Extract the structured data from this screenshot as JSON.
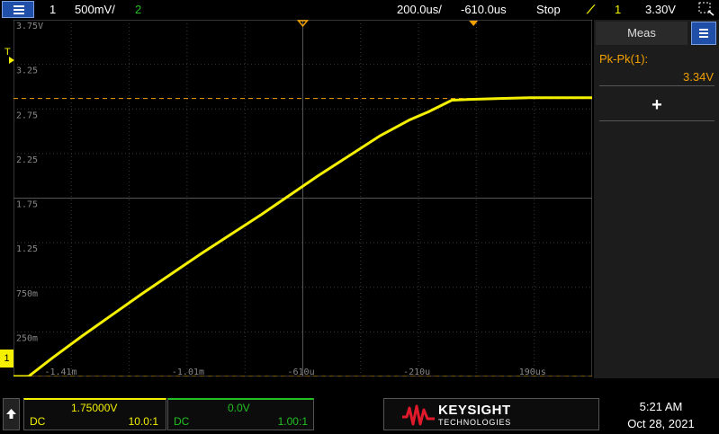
{
  "topbar": {
    "channel1_num": "1",
    "channel1_scale": "500mV/",
    "channel2_num": "2",
    "time_scale": "200.0us/",
    "time_offset": "-610.0us",
    "run_state": "Stop",
    "trigger_channel": "1",
    "trigger_level": "3.30V",
    "trigger_icon": "trigger-rising-edge-icon",
    "zoom_icon": "zoom-box-icon"
  },
  "graticule": {
    "y_tick_labels": [
      "3.75V",
      "3.25",
      "2.75",
      "2.25",
      "1.75",
      "1.25",
      "750m",
      "250m"
    ],
    "x_tick_labels": [
      "-1.41m",
      "-1.01m",
      "-610u",
      "-210u",
      "190us"
    ],
    "trigger_marker": "T",
    "ground_marker": "1"
  },
  "chart_data": {
    "type": "line",
    "title": "",
    "xlabel": "",
    "ylabel": "",
    "x_unit": "s",
    "y_unit": "V",
    "xlim": [
      -0.00163,
      0.00031
    ],
    "ylim": [
      0.0,
      4.0
    ],
    "grid": true,
    "series": [
      {
        "color": "#f4f000",
        "x": [
          -0.00163,
          -0.00158,
          -0.0015,
          -0.0014,
          -0.0012,
          -0.001,
          -0.0008,
          -0.00061,
          -0.0004,
          -0.0003,
          -0.00024,
          -0.00016,
          -0.0001,
          0.0,
          0.0001,
          0.0002,
          0.00031
        ],
        "y": [
          0.0,
          0.0,
          0.22,
          0.48,
          0.98,
          1.46,
          1.92,
          2.38,
          2.86,
          3.05,
          3.14,
          3.28,
          3.29,
          3.3,
          3.31,
          3.31,
          3.31
        ]
      }
    ],
    "reference_lines": [
      {
        "orientation": "horizontal",
        "value": 3.3,
        "color": "#f0a000",
        "label": "trigger level"
      },
      {
        "orientation": "horizontal",
        "value": 0.0,
        "color": "#f0a000",
        "label": "ground"
      }
    ]
  },
  "meas_panel": {
    "title": "Meas",
    "measurement_label": "Pk-Pk(1):",
    "measurement_value": "3.34V",
    "add_label": "+"
  },
  "bottom": {
    "ch1_offset": "1.75000V",
    "ch1_coupling": "DC",
    "ch1_probe": "10.0:1",
    "ch2_offset": "0.0V",
    "ch2_coupling": "DC",
    "ch2_probe": "1.00:1",
    "brand": "KEYSIGHT",
    "brand_sub": "TECHNOLOGIES",
    "time": "5:21 AM",
    "date": "Oct 28, 2021"
  },
  "colors": {
    "ch1": "#f4f000",
    "ch2": "#22c022",
    "accent_orange": "#f0a000",
    "menu_blue": "#1f4fa8",
    "brand_red": "#e01a2a"
  }
}
